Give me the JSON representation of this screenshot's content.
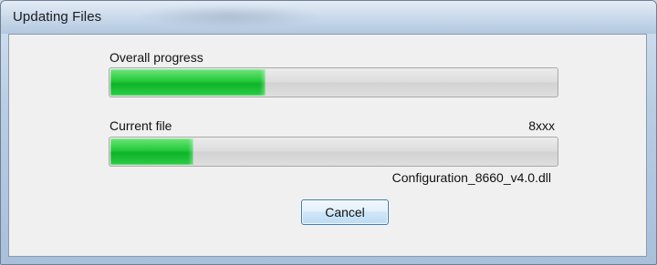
{
  "window": {
    "title": "Updating Files"
  },
  "overall": {
    "label": "Overall progress",
    "progress": 0.35
  },
  "current": {
    "label": "Current file",
    "counter": "8xxx",
    "progress": 0.19,
    "filename": "Configuration_8660_v4.0.dll"
  },
  "buttons": {
    "cancel_label": "Cancel"
  },
  "colors": {
    "progress_fill": "#1ec23a",
    "track": "#dcdcdc",
    "button_border": "#3c7fb1"
  }
}
